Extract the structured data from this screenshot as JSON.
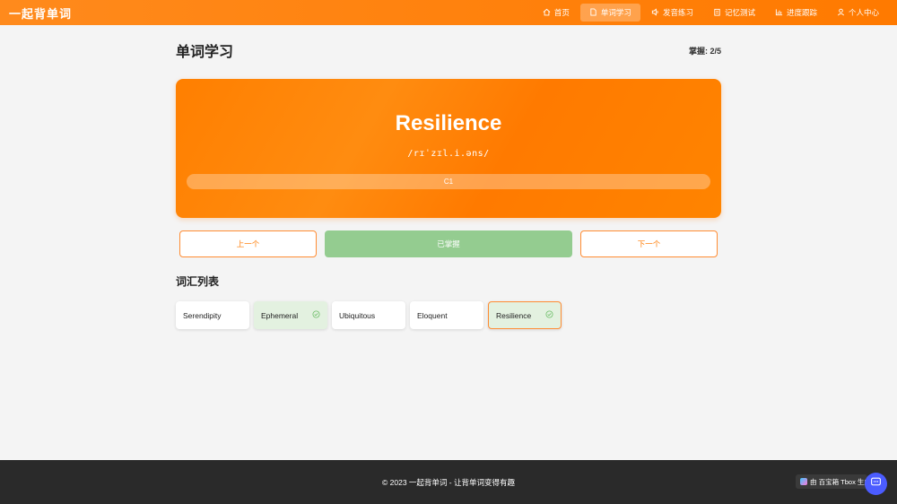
{
  "header": {
    "brand": "一起背单词",
    "nav": [
      {
        "label": "首页",
        "icon": "home-icon",
        "active": false
      },
      {
        "label": "单词学习",
        "icon": "document-icon",
        "active": true
      },
      {
        "label": "发音练习",
        "icon": "speaker-icon",
        "active": false
      },
      {
        "label": "记忆测试",
        "icon": "clipboard-icon",
        "active": false
      },
      {
        "label": "进度跟踪",
        "icon": "bar-chart-icon",
        "active": false
      },
      {
        "label": "个人中心",
        "icon": "user-icon",
        "active": false
      }
    ]
  },
  "page": {
    "title": "单词学习",
    "mastered_label": "掌握: 2/5"
  },
  "card": {
    "word": "Resilience",
    "phonetic": "/rɪˈzɪl.i.əns/",
    "level": "C1"
  },
  "buttons": {
    "prev": "上一个",
    "mastered": "已掌握",
    "next": "下一个"
  },
  "vocab": {
    "title": "词汇列表",
    "items": [
      {
        "word": "Serendipity",
        "learned": false,
        "current": false
      },
      {
        "word": "Ephemeral",
        "learned": true,
        "current": false
      },
      {
        "word": "Ubiquitous",
        "learned": false,
        "current": false
      },
      {
        "word": "Eloquent",
        "learned": false,
        "current": false
      },
      {
        "word": "Resilience",
        "learned": true,
        "current": true
      }
    ]
  },
  "footer": {
    "text": "© 2023 一起背单词 - 让背单词变得有趣"
  },
  "widget": {
    "tbox_label": "由 百宝箱 Tbox 生成"
  },
  "colors": {
    "accent": "#ff7a00",
    "mastered_button": "#94cc90",
    "learned_bg": "#e3f1e0",
    "footer_bg": "#2a2a2a"
  }
}
